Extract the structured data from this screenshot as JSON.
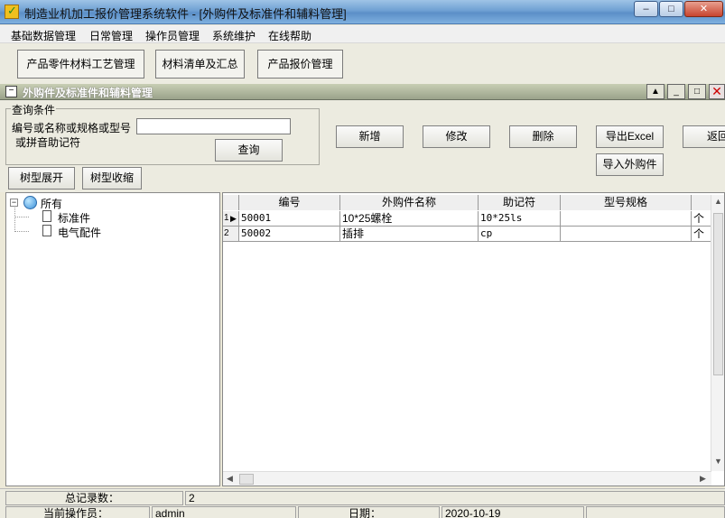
{
  "window": {
    "title": "制造业机加工报价管理系统软件 - [外购件及标准件和辅料管理]",
    "minimize": "–",
    "maximize": "□",
    "close": "✕"
  },
  "menu": [
    "基础数据管理",
    "日常管理",
    "操作员管理",
    "系统维护",
    "在线帮助"
  ],
  "toolbar": {
    "btn1": "产品零件材料工艺管理",
    "btn2": "材料清单及汇总",
    "btn3": "产品报价管理"
  },
  "child": {
    "title": "外购件及标准件和辅料管理",
    "icon": "−"
  },
  "query": {
    "legend": "查询条件",
    "label1": "编号或名称或规格或型号",
    "label2": "或拼音助记符",
    "input_value": "",
    "search": "查询",
    "add": "新增",
    "edit": "修改",
    "delete": "删除",
    "export": "导出Excel",
    "back": "返回",
    "import": "导入外购件",
    "expand": "树型展开",
    "collapse": "树型收缩"
  },
  "tree": {
    "root": "所有",
    "children": [
      "标准件",
      "电气配件"
    ]
  },
  "grid": {
    "columns": [
      "编号",
      "外购件名称",
      "助记符",
      "型号规格"
    ],
    "rows": [
      {
        "num": "1",
        "code": "50001",
        "name": "10*25螺栓",
        "mnemonic": "10*25ls",
        "spec": "",
        "unit": "个"
      },
      {
        "num": "2",
        "code": "50002",
        "name": "插排",
        "mnemonic": "cp",
        "spec": "",
        "unit": "个"
      }
    ]
  },
  "status": {
    "total_label": "总记录数：",
    "total_value": "2",
    "operator_label": "当前操作员：",
    "operator_value": "admin",
    "date_label": "日期：",
    "date_value": "2020-10-19"
  }
}
